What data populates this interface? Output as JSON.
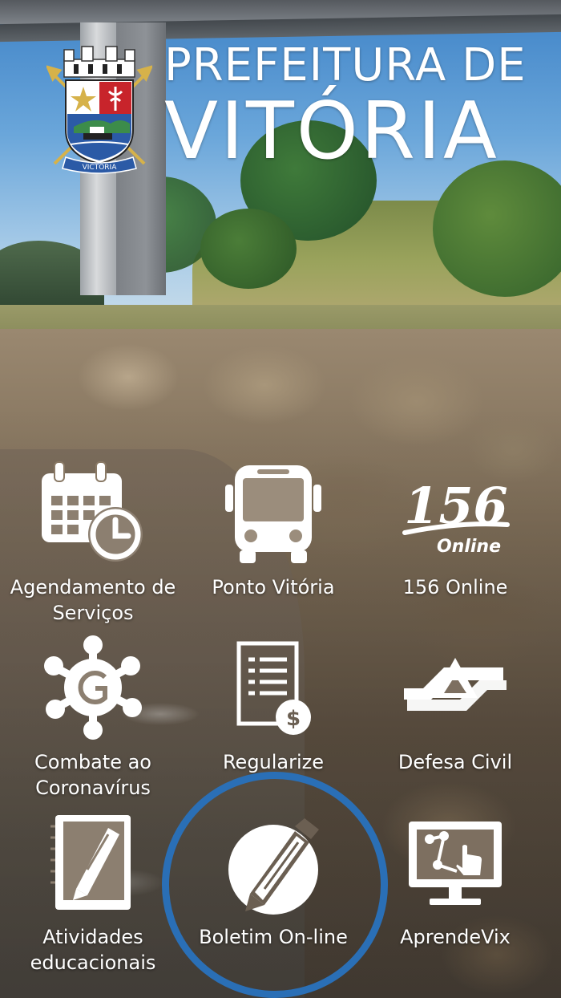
{
  "header": {
    "title_line1": "PREFEITURA DE",
    "title_line2": "VITÓRIA",
    "coat_of_arms_text": "VICTORIA"
  },
  "services": [
    {
      "id": "agendamento",
      "label": "Agendamento de\nServiços",
      "icon": "calendar-clock-icon"
    },
    {
      "id": "ponto",
      "label": "Ponto Vitória",
      "icon": "bus-icon"
    },
    {
      "id": "156",
      "label": "156 Online",
      "icon": "156-online-logo",
      "logo_number": "156",
      "logo_word": "Online"
    },
    {
      "id": "coronavirus",
      "label": "Combate ao\nCoronavírus",
      "icon": "virus-icon"
    },
    {
      "id": "regularize",
      "label": "Regularize",
      "icon": "document-dollar-icon"
    },
    {
      "id": "defesa",
      "label": "Defesa Civil",
      "icon": "civil-defense-icon"
    },
    {
      "id": "atividades",
      "label": "Atividades\neducacionais",
      "icon": "notebook-pencil-icon"
    },
    {
      "id": "boletim",
      "label": "Boletim On-line",
      "icon": "pencil-circle-icon",
      "highlighted": true
    },
    {
      "id": "aprendevix",
      "label": "AprendeVix",
      "icon": "monitor-touch-icon"
    }
  ],
  "colors": {
    "icon_white": "#ffffff",
    "highlight_ring": "#2a6fb6",
    "coat_red": "#c8242b",
    "coat_blue": "#2b5aa6",
    "coat_gold": "#d6b24a"
  }
}
